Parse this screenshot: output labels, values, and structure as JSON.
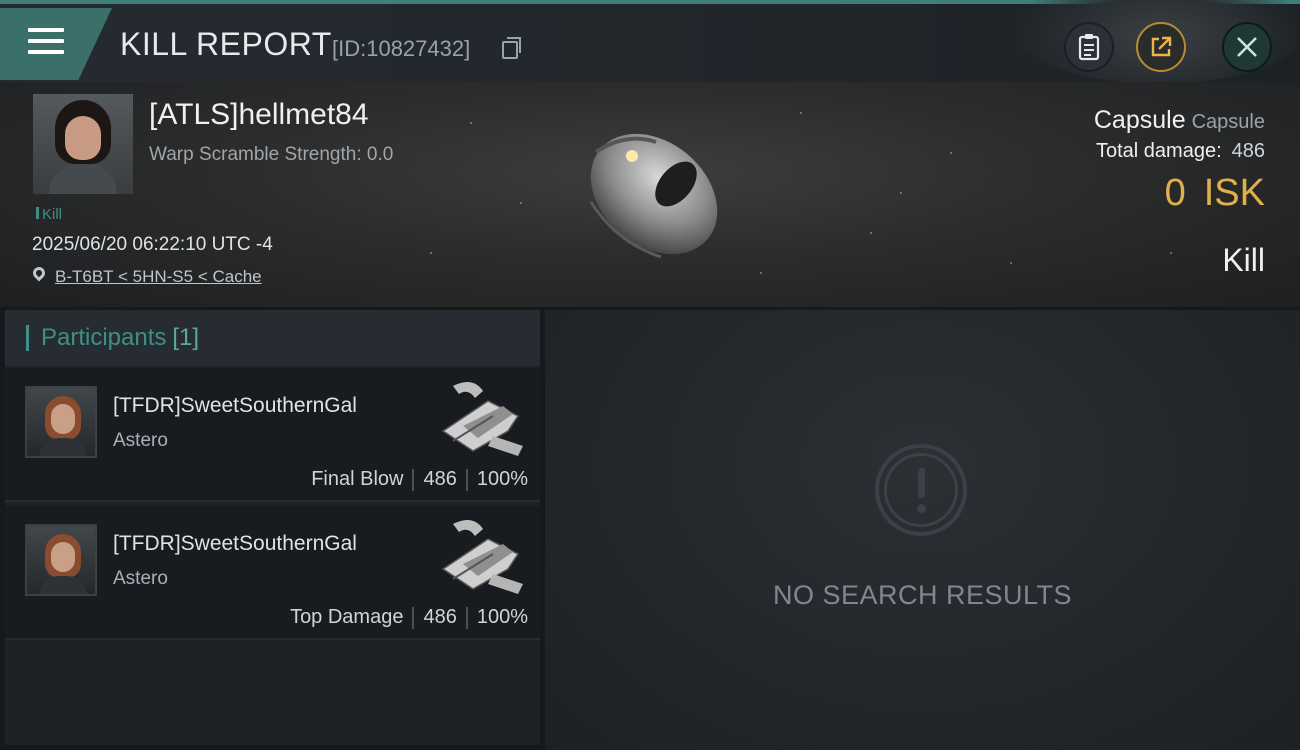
{
  "header": {
    "title": "KILL REPORT",
    "id_label": "[ID:10827432]"
  },
  "victim": {
    "name": "[ATLS]hellmet84",
    "warp_scramble": "Warp Scramble Strength: 0.0",
    "badge": "Kill",
    "datetime": "2025/06/20 06:22:10 UTC -4",
    "location": "B-T6BT < 5HN-S5 < Cache",
    "ship_name": "Capsule",
    "ship_class": "Capsule",
    "total_damage_label": "Total damage:",
    "total_damage_value": "486",
    "isk_value": "0",
    "isk_unit": "ISK",
    "kill_type": "Kill"
  },
  "participants": {
    "label": "Participants",
    "count": "[1]",
    "rows": [
      {
        "name": "[TFDR]SweetSouthernGal",
        "ship": "Astero",
        "role": "Final Blow",
        "damage": "486",
        "percent": "100%"
      },
      {
        "name": "[TFDR]SweetSouthernGal",
        "ship": "Astero",
        "role": "Top Damage",
        "damage": "486",
        "percent": "100%"
      }
    ]
  },
  "results": {
    "empty_text": "NO SEARCH RESULTS"
  },
  "colors": {
    "accent_teal": "#3f8f88",
    "isk_gold": "#e0b14a",
    "close_button_border": "#1b1f23",
    "share_button_border": "#b98a35"
  },
  "icons": {
    "menu": "hamburger-icon",
    "copy": "copy-icon",
    "clipboard": "clipboard-icon",
    "share": "share-icon",
    "close": "close-icon",
    "location": "location-pin-icon",
    "empty": "exclamation-icon"
  }
}
